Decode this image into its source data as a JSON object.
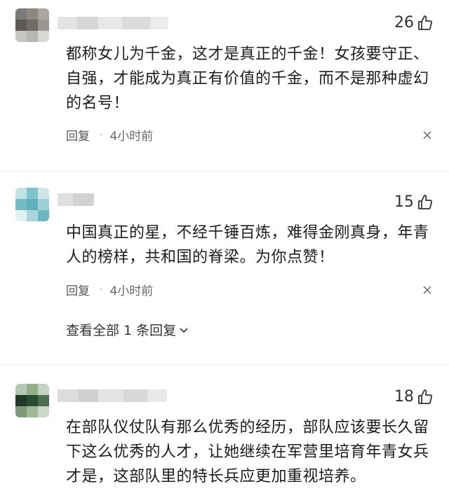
{
  "comments": [
    {
      "likes": "26",
      "text": "都称女儿为千金，这才是真正的千金！女孩要守正、自强，才能成为真正有价值的千金，而不是那种虚幻的名号！",
      "reply_label": "回复",
      "separator": "·",
      "time": "4小时前"
    },
    {
      "likes": "15",
      "text": "中国真正的星，不经千锤百炼，难得金刚真身，年青人的榜样，共和国的脊梁。为你点赞！",
      "reply_label": "回复",
      "separator": "·",
      "time": "4小时前",
      "view_replies": "查看全部 1 条回复"
    },
    {
      "likes": "18",
      "text": "在部队仪仗队有那么优秀的经历，部队应该要长久留下这么优秀的人才，让她继续在军营里培育年青女兵才是，这部队里的特长兵应更加重视培养。"
    }
  ],
  "icons": {
    "like": "thumbs-up-icon",
    "close": "close-icon",
    "chevron": "chevron-down-icon"
  },
  "colors": {
    "text": "#1c1c1c",
    "muted": "#666666",
    "divider": "#efefef"
  }
}
